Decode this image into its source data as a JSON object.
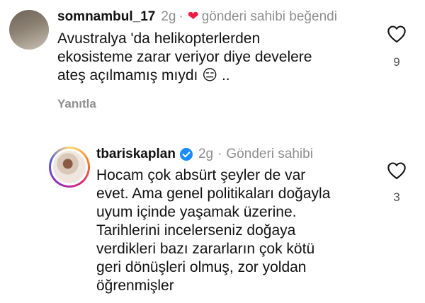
{
  "comments": [
    {
      "username": "somnambul_17",
      "time": "2g",
      "separator": "·",
      "liked_by_author_label": "gönderi sahibi beğendi",
      "lines": [
        "Avustralya 'da helikopterlerden",
        "ekosisteme zarar veriyor diye develere",
        "ateş açılmamış mıydı 😑 .."
      ],
      "reply_label": "Yanıtla",
      "like_count": "9"
    },
    {
      "username": "tbariskaplan",
      "time": "2g",
      "separator": "·",
      "author_label": "Gönderi sahibi",
      "lines": [
        "Hocam çok absürt şeyler de var",
        "evet. Ama genel politikaları doğayla",
        "uyum içinde yaşamak üzerine.",
        "Tarihlerini incelerseniz doğaya",
        "verdikleri bazı zararların çok kötü",
        "geri dönüşleri olmuş, zor yoldan",
        "öğrenmişler"
      ],
      "like_count": "3"
    }
  ],
  "icons": {
    "author_liked": "heart-filled-icon",
    "like": "heart-outline-icon",
    "verified": "verified-badge-icon"
  },
  "colors": {
    "muted_text": "#8e8e8e",
    "heart_red": "#ed1b45",
    "verified_blue": "#1a8cff"
  }
}
